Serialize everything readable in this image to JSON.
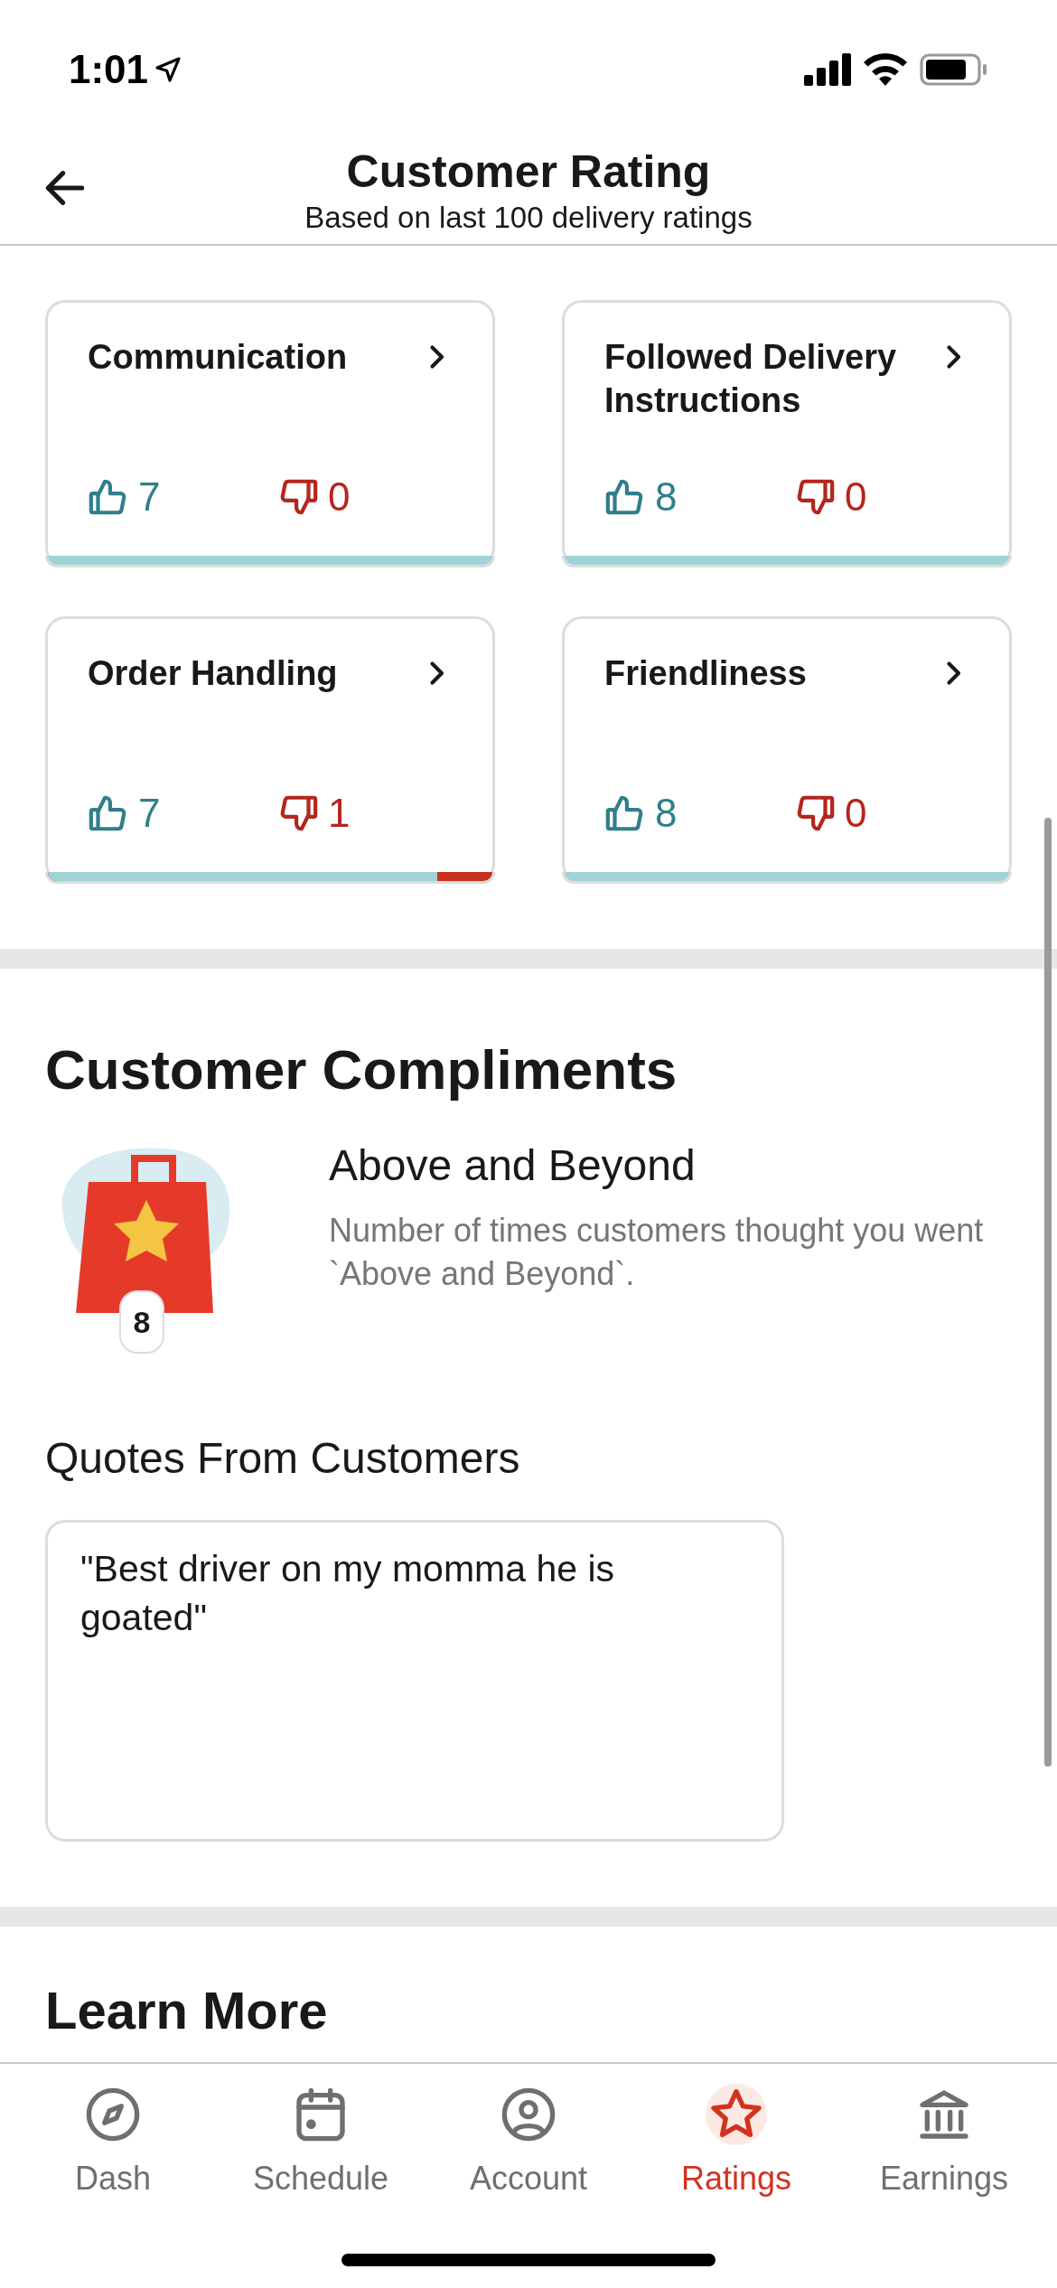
{
  "status_bar": {
    "time": "1:01"
  },
  "header": {
    "title": "Customer Rating",
    "subtitle": "Based on last 100 delivery ratings"
  },
  "categories": [
    {
      "title": "Communication",
      "up": "7",
      "down": "0",
      "level": 1
    },
    {
      "title": "Followed Delivery Instructions",
      "up": "8",
      "down": "0",
      "level": 1
    },
    {
      "title": "Order Handling",
      "up": "7",
      "down": "1",
      "level": 0.875
    },
    {
      "title": "Friendliness",
      "up": "8",
      "down": "0",
      "level": 1
    }
  ],
  "compliments": {
    "heading": "Customer Compliments",
    "badge": {
      "title": "Above and Beyond",
      "count": "8",
      "description": "Number of times customers thought you went `Above and Beyond`."
    },
    "quotes_heading": "Quotes From Customers",
    "quotes": [
      "\"Best driver on my momma he is goated\""
    ]
  },
  "learn_more": {
    "heading": "Learn More"
  },
  "tab_bar": [
    {
      "label": "Dash",
      "kind": "compass",
      "selected": false
    },
    {
      "label": "Schedule",
      "kind": "calendar",
      "selected": false
    },
    {
      "label": "Account",
      "kind": "person",
      "selected": false
    },
    {
      "label": "Ratings",
      "kind": "star",
      "selected": true
    },
    {
      "label": "Earnings",
      "kind": "bank",
      "selected": false
    }
  ]
}
